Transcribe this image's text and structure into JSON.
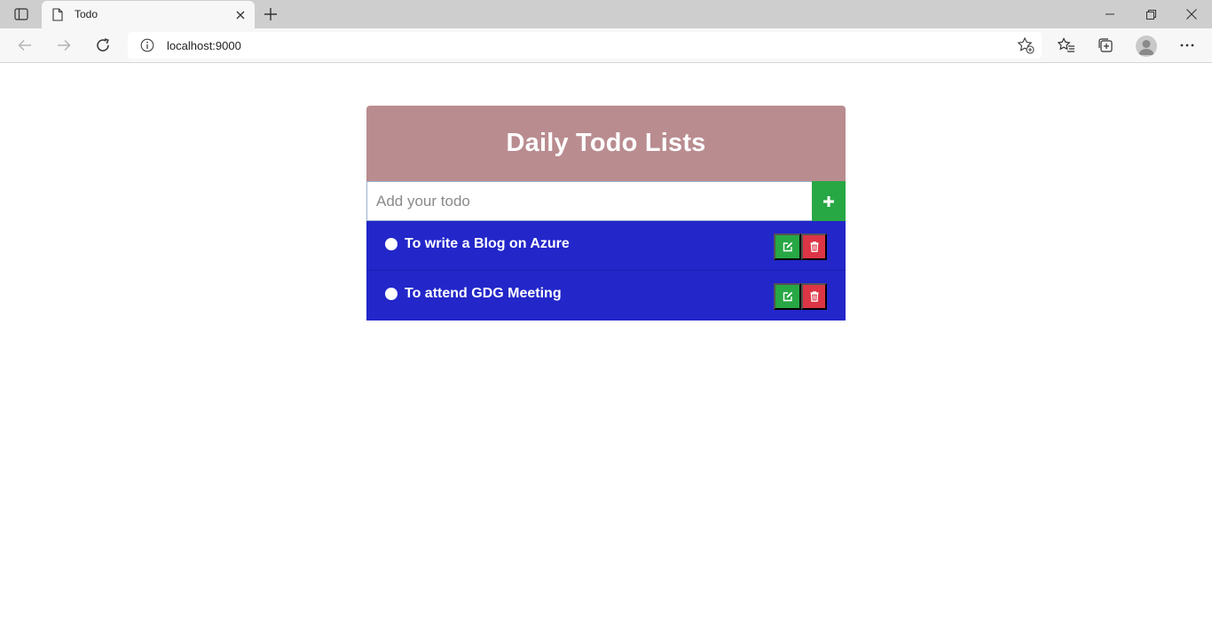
{
  "browser": {
    "tab_title": "Todo",
    "url": "localhost:9000"
  },
  "app": {
    "title": "Daily Todo Lists",
    "input_placeholder": "Add your todo",
    "input_value": "",
    "add_icon": "plus-icon",
    "todos": [
      {
        "text": "To write a Blog on Azure",
        "edit_icon": "edit-icon",
        "delete_icon": "trash-icon"
      },
      {
        "text": "To attend GDG Meeting",
        "edit_icon": "edit-icon",
        "delete_icon": "trash-icon"
      }
    ]
  },
  "colors": {
    "header_bg": "#b98c90",
    "list_bg": "#2326c9",
    "add_button": "#28a745",
    "edit_button": "#28a745",
    "delete_button": "#dc3545",
    "text_on_dark": "#ffffff"
  }
}
